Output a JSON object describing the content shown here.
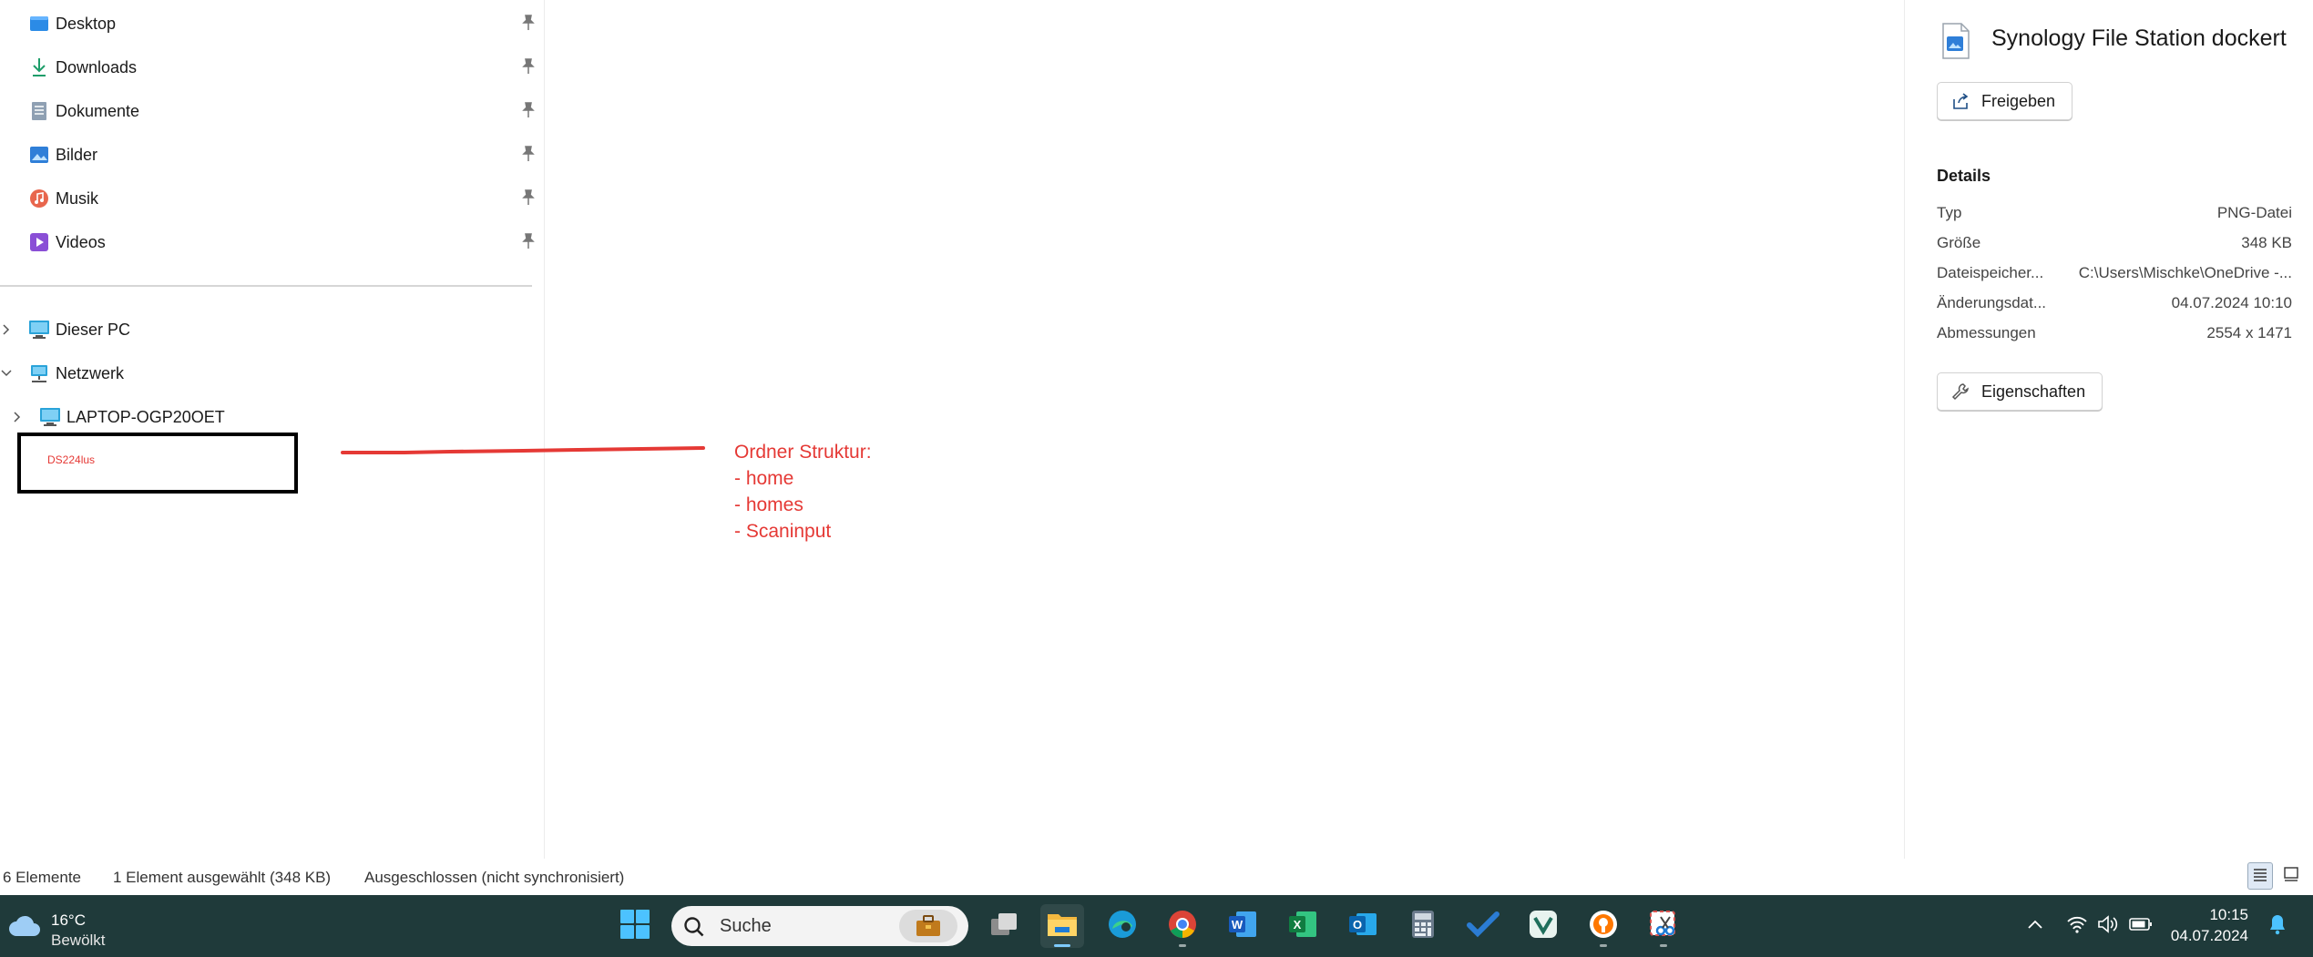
{
  "nav": {
    "quick_access": [
      {
        "label": "Desktop",
        "icon": "desktop-folder-icon"
      },
      {
        "label": "Downloads",
        "icon": "download-icon"
      },
      {
        "label": "Dokumente",
        "icon": "documents-icon"
      },
      {
        "label": "Bilder",
        "icon": "pictures-icon"
      },
      {
        "label": "Musik",
        "icon": "music-icon"
      },
      {
        "label": "Videos",
        "icon": "videos-icon"
      }
    ],
    "this_pc": "Dieser PC",
    "network": "Netzwerk",
    "network_child": "LAPTOP-OGP20OET"
  },
  "annotation": {
    "redacted_label": "DS224lus",
    "lines": [
      "Ordner Struktur:",
      "",
      "- home",
      "- homes",
      "- Scaninput"
    ],
    "color": "#e53935"
  },
  "details": {
    "file_name": "Synology File Station dockert",
    "share_label": "Freigeben",
    "heading": "Details",
    "rows": [
      {
        "key": "Typ",
        "value": "PNG-Datei"
      },
      {
        "key": "Größe",
        "value": "348 KB"
      },
      {
        "key": "Dateispeicher...",
        "value": "C:\\Users\\Mischke\\OneDrive -..."
      },
      {
        "key": "Änderungsdat...",
        "value": "04.07.2024 10:10"
      },
      {
        "key": "Abmessungen",
        "value": "2554 x 1471"
      }
    ],
    "properties_label": "Eigenschaften"
  },
  "statusbar": {
    "count": "6 Elemente",
    "selected": "1 Element ausgewählt (348 KB)",
    "sync": "Ausgeschlossen (nicht synchronisiert)"
  },
  "taskbar": {
    "weather_temp": "16°C",
    "weather_desc": "Bewölkt",
    "search_placeholder": "Suche",
    "apps": [
      "start",
      "task-view",
      "file-explorer",
      "edge",
      "chrome",
      "word",
      "excel",
      "outlook",
      "calculator",
      "todo",
      "vpn",
      "avast",
      "snipping-tool"
    ],
    "time": "10:15",
    "date": "04.07.2024",
    "bg_color": "#1f3a3a"
  }
}
